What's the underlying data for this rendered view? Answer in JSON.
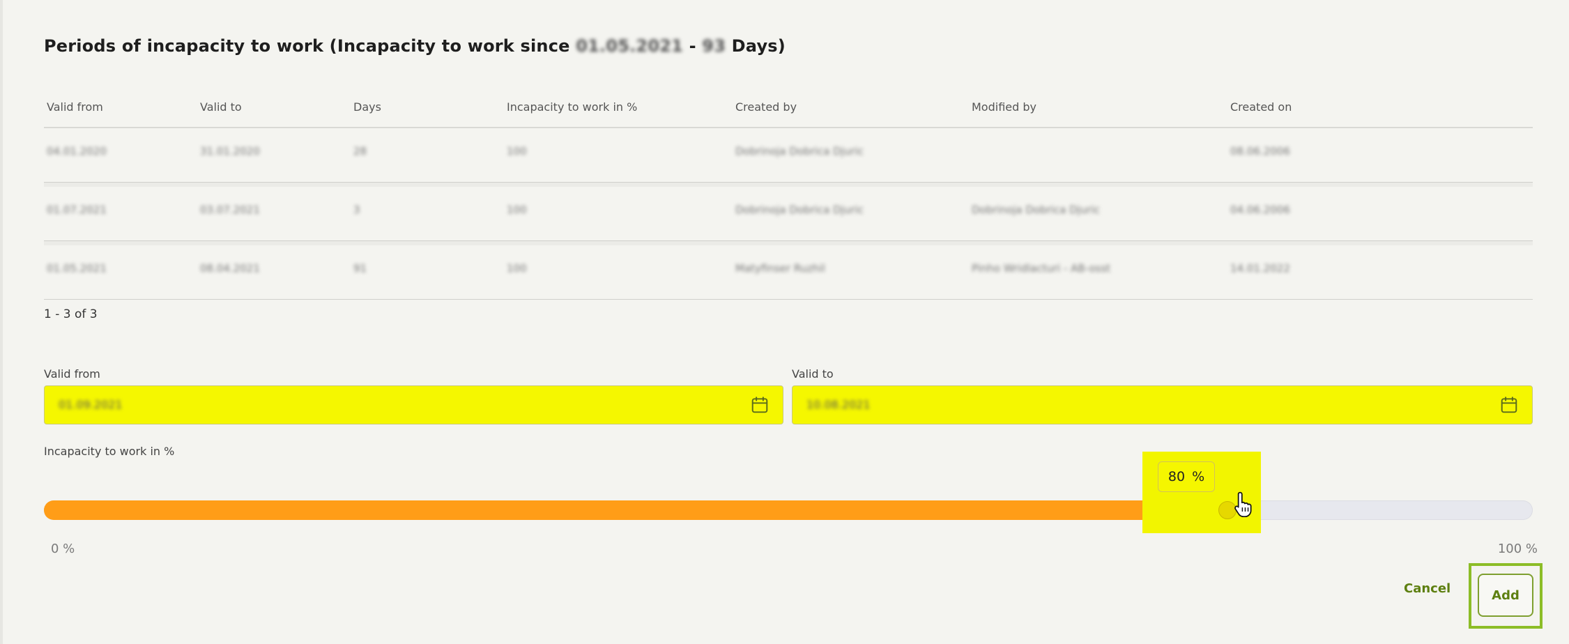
{
  "section": {
    "title_prefix": "Periods of incapacity to work (Incapacity to work since ",
    "since_date": "01.05.2021",
    "since_separator": " - ",
    "since_days": "93",
    "title_suffix": " Days)"
  },
  "table": {
    "columns": [
      "Valid from",
      "Valid to",
      "Days",
      "Incapacity to work in %",
      "Created by",
      "Modified by",
      "Created on"
    ],
    "rows": [
      [
        "04.01.2020",
        "31.01.2020",
        "28",
        "100",
        "Dobrinoja Dobrica Djuric",
        "",
        "08.06.2006"
      ],
      [
        "01.07.2021",
        "03.07.2021",
        "3",
        "100",
        "Dobrinoja Dobrica Djuric",
        "Dobrinoja Dobrica Djuric",
        "04.06.2006"
      ],
      [
        "01.05.2021",
        "08.04.2021",
        "91",
        "100",
        "Matyfinser Ruzhil",
        "Pinho Wridlacturi - AB-osst",
        "14.01.2022"
      ]
    ]
  },
  "pager": {
    "text": "1 - 3 of 3"
  },
  "form": {
    "valid_from_label": "Valid from",
    "valid_from_value": "01.09.2021",
    "valid_to_label": "Valid to",
    "valid_to_value": "10.08.2021",
    "slider_label": "Incapacity to work in %",
    "slider_value": "80",
    "slider_unit": "%",
    "slider_fraction": 0.8,
    "min_label": "0 %",
    "max_label": "100 %"
  },
  "actions": {
    "cancel_label": "Cancel",
    "add_label": "Add"
  },
  "colors": {
    "highlight": "#f5f700",
    "slider_fill": "#ff9d17",
    "accent": "#5d7f10"
  }
}
